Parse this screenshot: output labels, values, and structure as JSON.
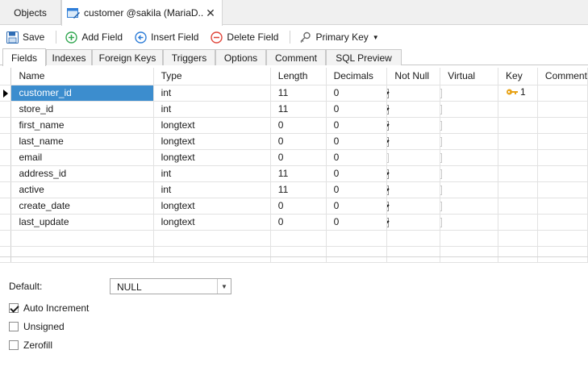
{
  "doc_tabs": {
    "objects": "Objects",
    "active_title": "customer @sakila (MariaD...",
    "close_glyph": "✕"
  },
  "toolbar": {
    "save": "Save",
    "add_field": "Add Field",
    "insert_field": "Insert Field",
    "delete_field": "Delete Field",
    "primary_key": "Primary Key"
  },
  "sub_tabs": [
    "Fields",
    "Indexes",
    "Foreign Keys",
    "Triggers",
    "Options",
    "Comment",
    "SQL Preview"
  ],
  "columns": [
    "Name",
    "Type",
    "Length",
    "Decimals",
    "Not Null",
    "Virtual",
    "Key",
    "Comment"
  ],
  "rows": [
    {
      "name": "customer_id",
      "type": "int",
      "length": "11",
      "decimals": "0",
      "not_null": true,
      "key": "1"
    },
    {
      "name": "store_id",
      "type": "int",
      "length": "11",
      "decimals": "0",
      "not_null": true,
      "key": ""
    },
    {
      "name": "first_name",
      "type": "longtext",
      "length": "0",
      "decimals": "0",
      "not_null": true,
      "key": ""
    },
    {
      "name": "last_name",
      "type": "longtext",
      "length": "0",
      "decimals": "0",
      "not_null": true,
      "key": ""
    },
    {
      "name": "email",
      "type": "longtext",
      "length": "0",
      "decimals": "0",
      "not_null": false,
      "key": ""
    },
    {
      "name": "address_id",
      "type": "int",
      "length": "11",
      "decimals": "0",
      "not_null": true,
      "key": ""
    },
    {
      "name": "active",
      "type": "int",
      "length": "11",
      "decimals": "0",
      "not_null": true,
      "key": ""
    },
    {
      "name": "create_date",
      "type": "longtext",
      "length": "0",
      "decimals": "0",
      "not_null": true,
      "key": ""
    },
    {
      "name": "last_update",
      "type": "longtext",
      "length": "0",
      "decimals": "0",
      "not_null": true,
      "key": ""
    }
  ],
  "properties": {
    "default_label": "Default:",
    "default_value": "NULL",
    "auto_increment": "Auto Increment",
    "auto_increment_checked": true,
    "unsigned": "Unsigned",
    "unsigned_checked": false,
    "zerofill": "Zerofill",
    "zerofill_checked": false
  },
  "colors": {
    "selection": "#3c8dce",
    "key_icon": "#e8a317"
  }
}
